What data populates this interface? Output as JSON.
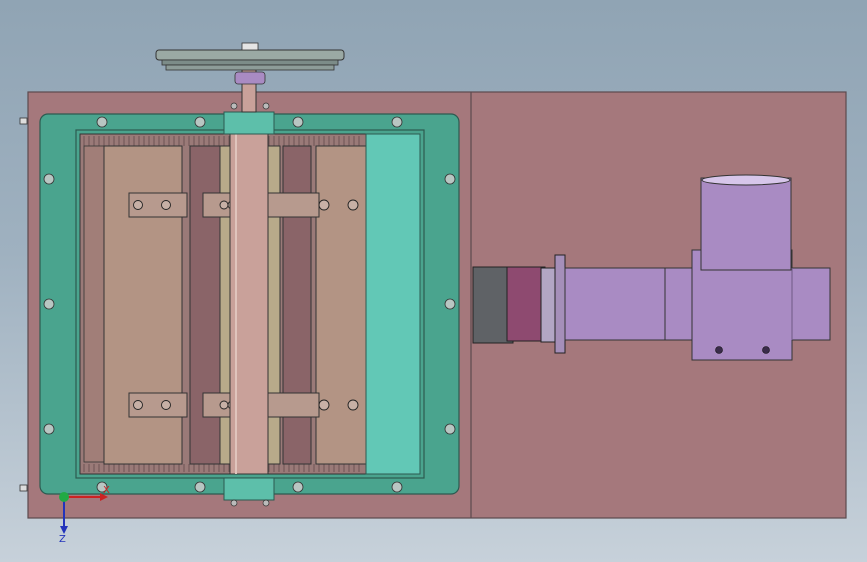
{
  "viewport": {
    "name": "CAD top view",
    "background_top": "#90a4b4",
    "background_bottom": "#c7d1da"
  },
  "colors": {
    "base_plate": "#a5787c",
    "base_plate_edge": "#5c4a4e",
    "frame_teal": "#4aa48e",
    "frame_teal_light": "#62c8b6",
    "panel_tan": "#b39484",
    "panel_mauve": "#8a6468",
    "shaft": "#c9a19a",
    "motor_lilac": "#a98bc3",
    "motor_lilac_dark": "#8a6fa6",
    "pipe_grey": "#5f6266",
    "flange_magenta": "#8e4a70"
  },
  "triad": {
    "x_label": "X",
    "z_label": "Z",
    "x_color": "#cc2222",
    "z_color": "#2233bb",
    "origin_color": "#22aa44"
  }
}
